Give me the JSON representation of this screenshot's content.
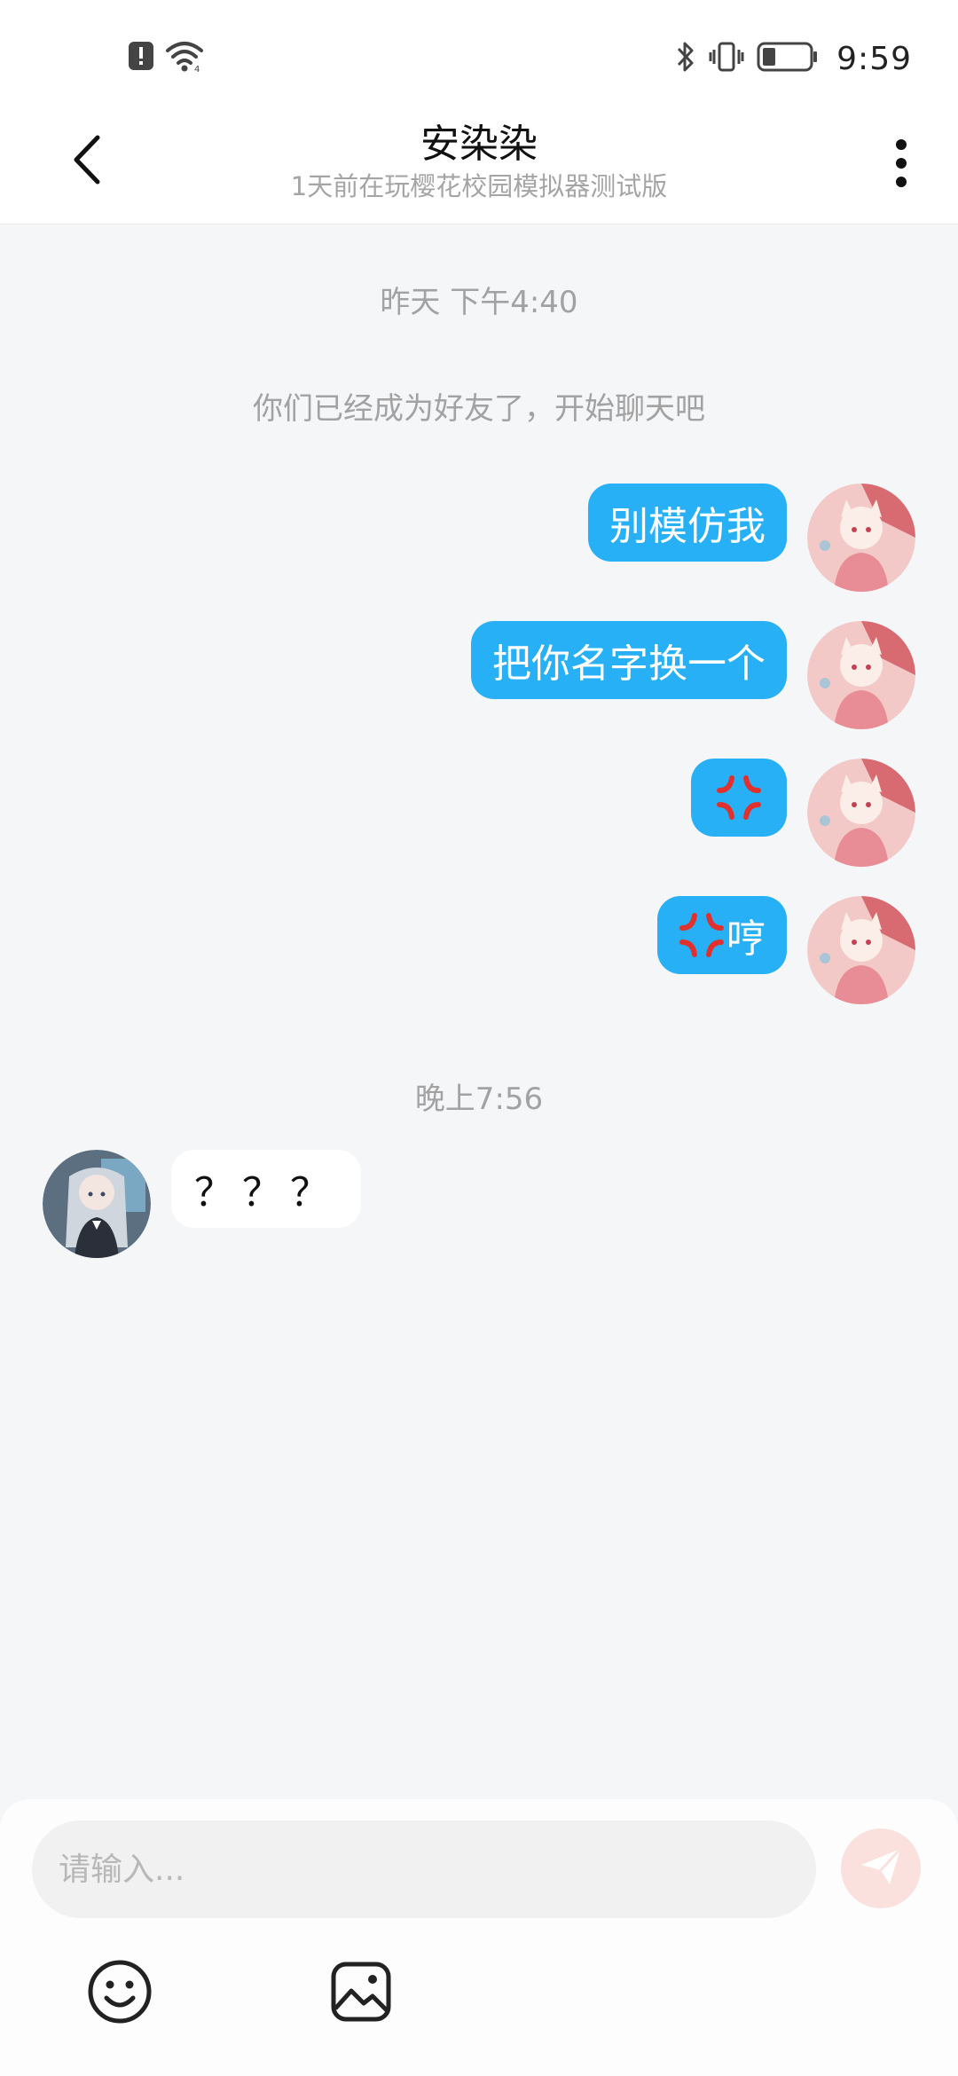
{
  "status_bar": {
    "time": "9:59",
    "icons": [
      "alert-icon",
      "wifi-icon",
      "bluetooth-icon",
      "vibrate-icon",
      "battery-icon"
    ]
  },
  "header": {
    "title": "安染染",
    "subtitle": "1天前在玩樱花校园模拟器测试版",
    "back_icon": "chevron-left-icon",
    "more_icon": "more-vertical-icon"
  },
  "chat": {
    "timestamp_1": "昨天 下午4:40",
    "system_message": "你们已经成为好友了，开始聊天吧",
    "outgoing": [
      {
        "text": "别模仿我"
      },
      {
        "text": "把你名字换一个"
      },
      {
        "text": "",
        "emoji": "angry-vein-icon"
      },
      {
        "text": "哼",
        "emoji": "angry-vein-icon"
      }
    ],
    "timestamp_2": "晚上7:56",
    "incoming": [
      {
        "text": "？？？"
      }
    ]
  },
  "composer": {
    "placeholder": "请输入...",
    "send_icon": "send-icon",
    "emoji_icon": "smiley-icon",
    "image_icon": "image-icon"
  },
  "colors": {
    "accent_bubble": "#27b0f5",
    "send_button": "#fbe1de",
    "background": "#f5f6f8"
  }
}
